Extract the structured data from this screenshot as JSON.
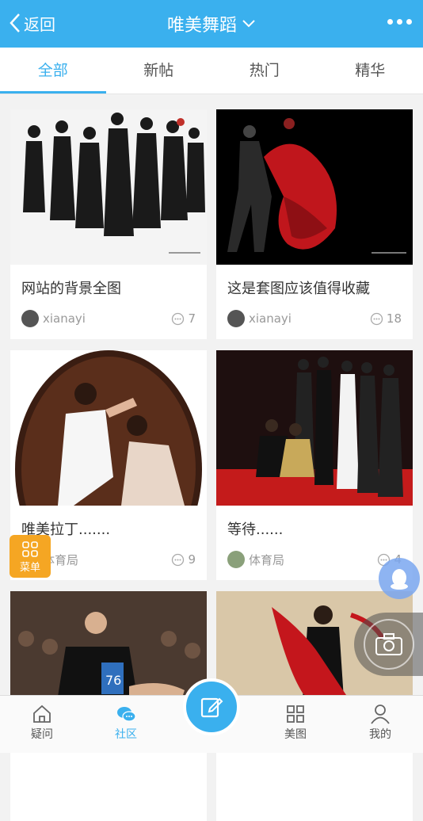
{
  "header": {
    "back_label": "返回",
    "title": "唯美舞蹈"
  },
  "tabs": [
    {
      "label": "全部",
      "active": true
    },
    {
      "label": "新帖",
      "active": false
    },
    {
      "label": "热门",
      "active": false
    },
    {
      "label": "精华",
      "active": false
    }
  ],
  "posts": [
    {
      "title": "网站的背景全图",
      "user": "xianayi",
      "comments": "7",
      "image": "dancers-group-black-costumes"
    },
    {
      "title": "这是套图应该值得收藏",
      "user": "xianayi",
      "comments": "18",
      "image": "dancer-red-dress-dark-stage"
    },
    {
      "title": "唯美拉丁.......",
      "user": "体育局",
      "comments": "9",
      "image": "latin-couple-oval-frame"
    },
    {
      "title": "等待......",
      "user": "体育局",
      "comments": "4",
      "image": "dancers-waiting-red-stage"
    },
    {
      "title": "",
      "user": "",
      "comments": "",
      "image": "ballroom-dancer-number-76"
    },
    {
      "title": "",
      "user": "",
      "comments": "",
      "image": "dancer-red-dress-competition"
    }
  ],
  "floating": {
    "menu_label": "菜单"
  },
  "tabbar": {
    "items": [
      {
        "label": "疑问",
        "icon": "home-icon"
      },
      {
        "label": "社区",
        "icon": "chat-bubbles-icon",
        "active": true
      },
      {
        "label": "美图",
        "icon": "grid-icon"
      },
      {
        "label": "我的",
        "icon": "person-icon"
      }
    ]
  },
  "colors": {
    "accent": "#3ab0ee",
    "menu": "#f5a623"
  }
}
